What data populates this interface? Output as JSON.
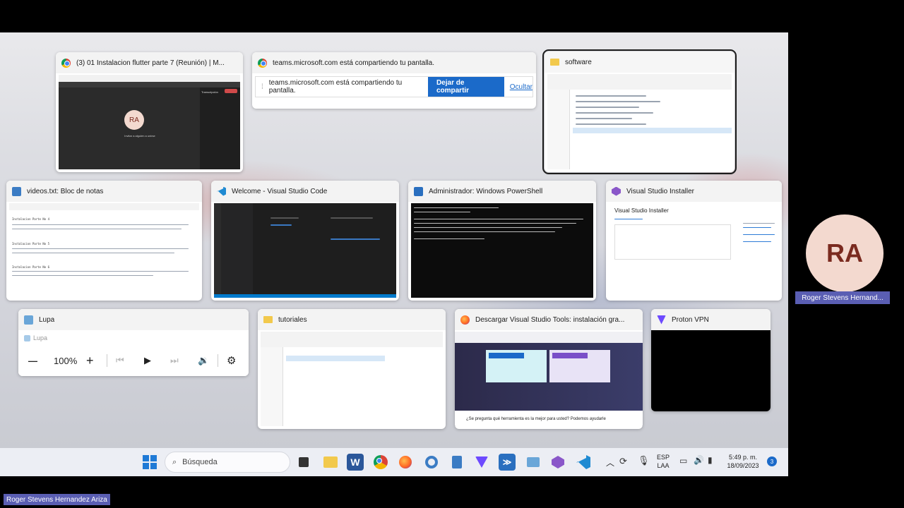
{
  "windows": {
    "chrome_teams": {
      "title": "(3) 01 Instalacion flutter parte 7 (Reunión) | M...",
      "avatar": "RA",
      "invite": "Invitar a alguien a unirse",
      "panel_title": "Transcripción"
    },
    "share_bar": {
      "title": "teams.microsoft.com está compartiendo tu pantalla.",
      "message": "teams.microsoft.com está compartiendo tu pantalla.",
      "stop_button": "Dejar de compartir",
      "hide_link": "Ocultar"
    },
    "software": {
      "title": "software"
    },
    "notepad": {
      "title": "videos.txt: Bloc de notas",
      "lines": [
        "Instalacion Parte No 4",
        "Instalacion Parte No 5",
        "Instalacion Parte No 6"
      ]
    },
    "vscode": {
      "title": "Welcome - Visual Studio Code"
    },
    "powershell": {
      "title": "Administrador: Windows PowerShell"
    },
    "vs_installer": {
      "title": "Visual Studio Installer",
      "heading": "Visual Studio Installer"
    },
    "lupa": {
      "title": "Lupa",
      "inner_title": "Lupa",
      "zoom": "100%",
      "minus": "—",
      "plus": "+"
    },
    "tutoriales": {
      "title": "tutoriales"
    },
    "firefox": {
      "title": "Descargar Visual Studio Tools: instalación gra...",
      "footer": "¿Se pregunta qué herramienta es la mejor para usted? Podemos ayudarle"
    },
    "protonvpn": {
      "title": "Proton VPN"
    }
  },
  "taskbar": {
    "search_placeholder": "Búsqueda",
    "lang_top": "ESP",
    "lang_bottom": "LAA",
    "time": "5:49 p. m.",
    "date": "18/09/2023",
    "notifications": "3"
  },
  "participant": {
    "initials": "RA",
    "name": "Roger Stevens Hernand..."
  },
  "presenter_name": "Roger Stevens Hernandez Ariza",
  "colors": {
    "accent": "#1b6ac9",
    "teams_purple": "#5a5eb3",
    "avatar_bg": "#f3d9cf"
  }
}
